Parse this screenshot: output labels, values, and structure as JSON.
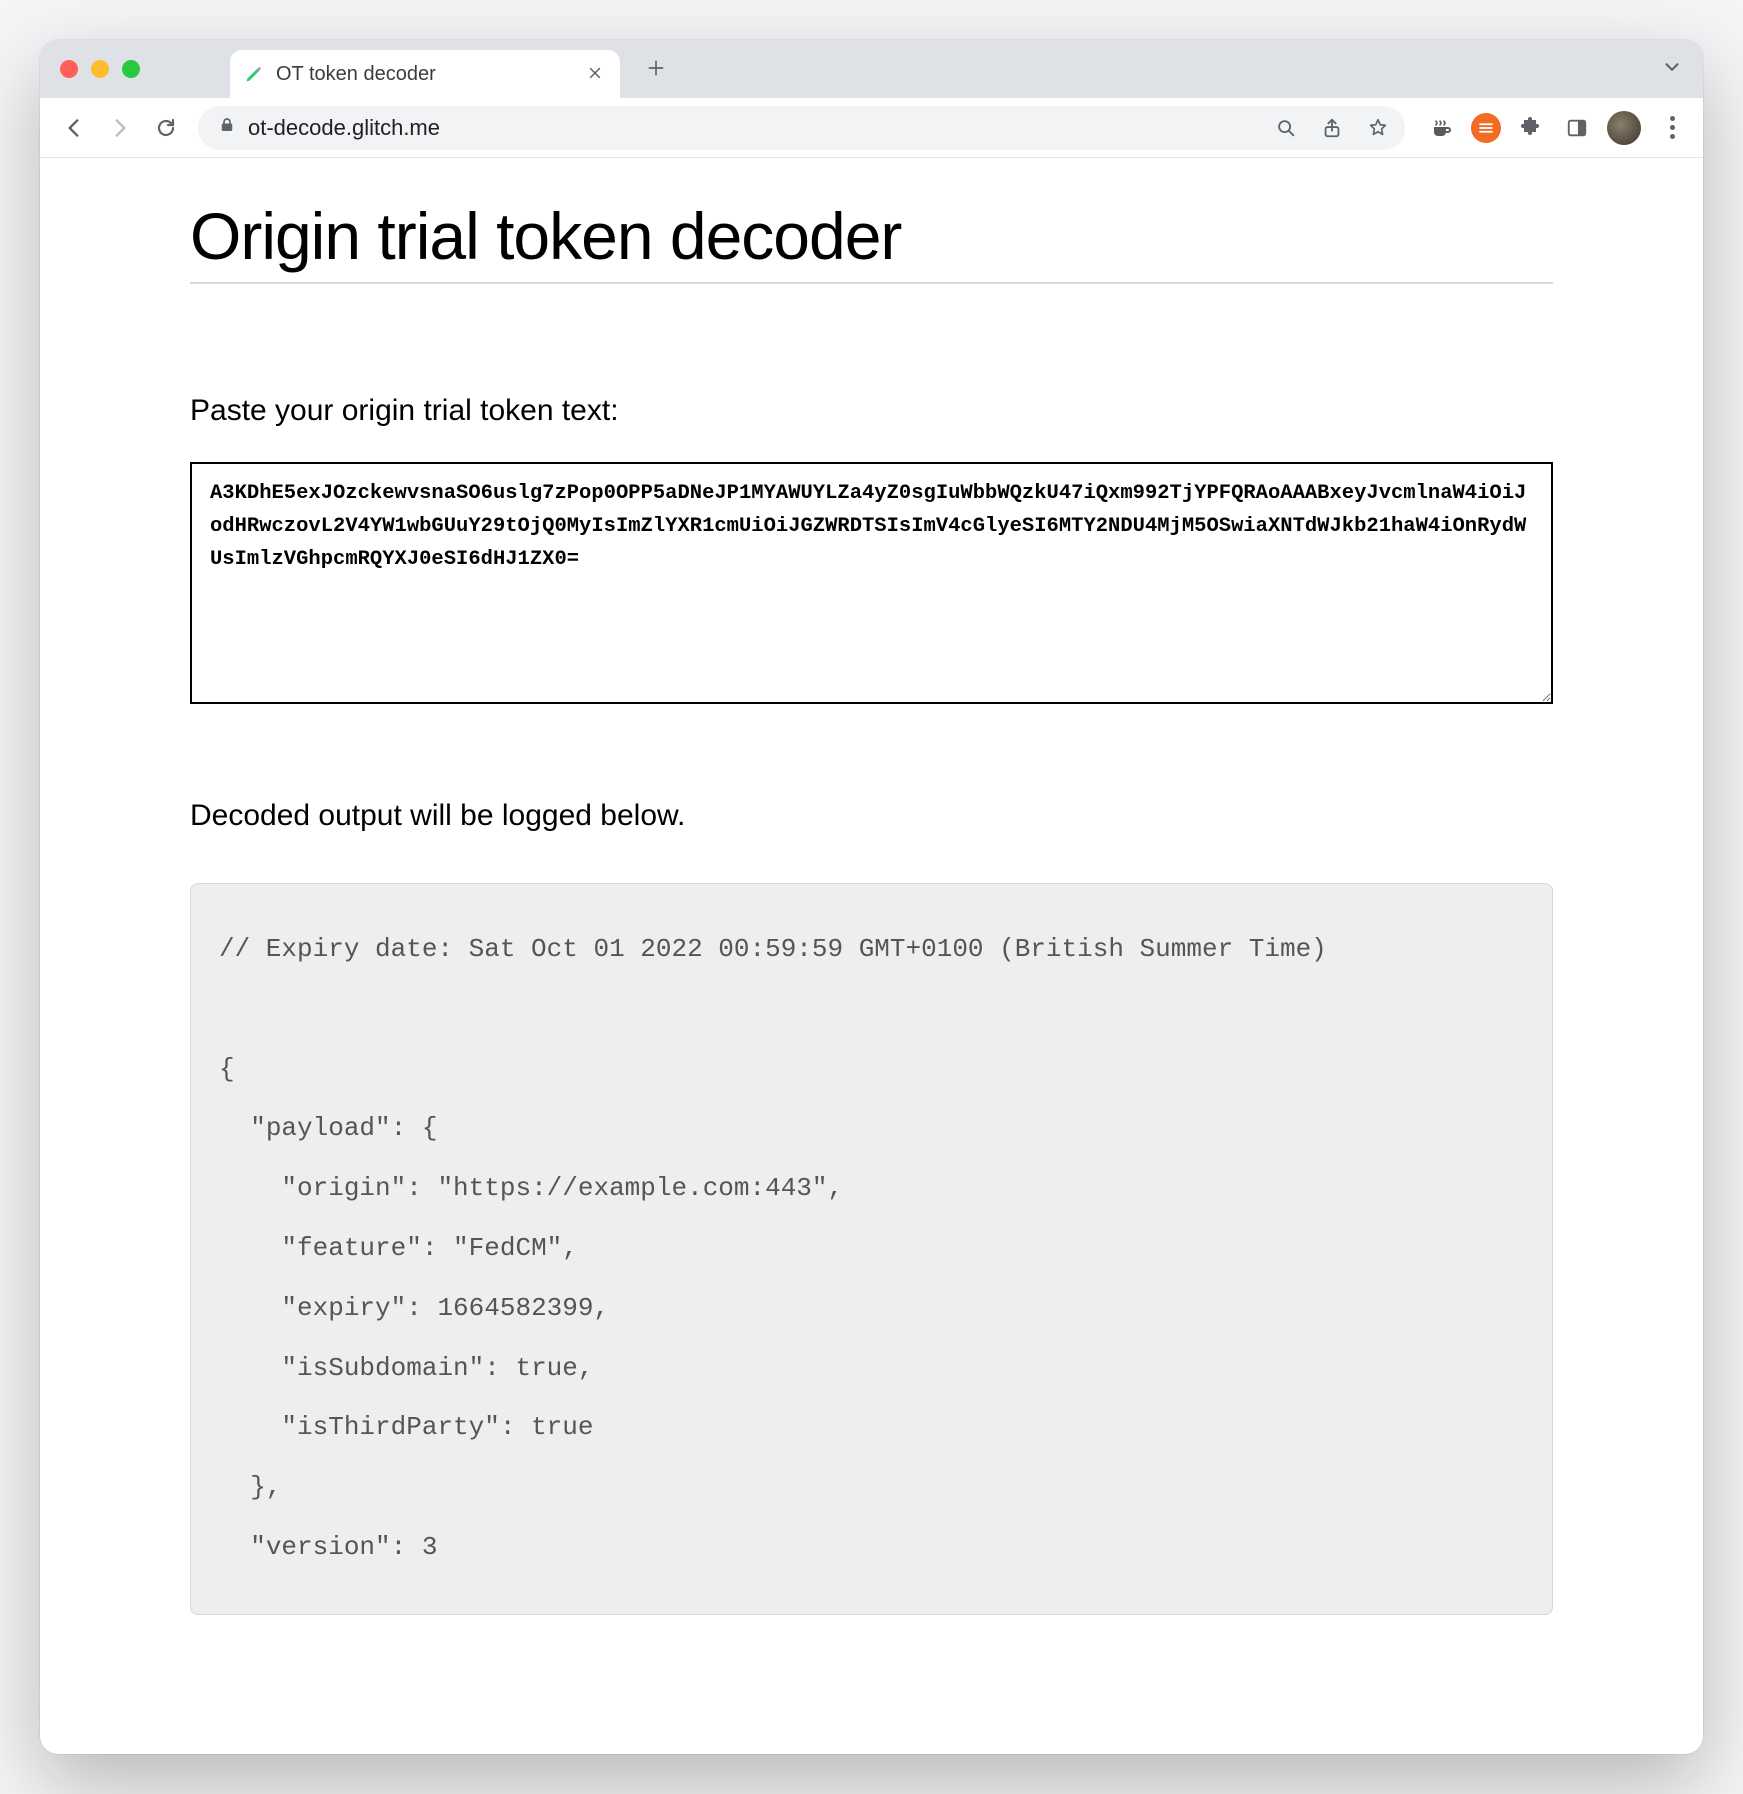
{
  "tab": {
    "title": "OT token decoder"
  },
  "omnibox": {
    "url": "ot-decode.glitch.me"
  },
  "page": {
    "title": "Origin trial token decoder",
    "paste_heading": "Paste your origin trial token text:",
    "output_heading": "Decoded output will be logged below.",
    "token_value": "A3KDhE5exJOzckewvsnaSO6uslg7zPop0OPP5aDNeJP1MYAWUYLZa4yZ0sgIuWbbWQzkU47iQxm992TjYPFQRAoAAABxeyJvcmlnaW4iOiJodHRwczovL2V4YW1wbGUuY29tOjQ0MyIsImZlYXR1cmUiOiJGZWRDTSIsImV4cGlyeSI6MTY2NDU4MjM5OSwiaXNTdWJkb21haW4iOnRydWUsImlzVGhpcmRQYXJ0eSI6dHJ1ZX0=",
    "decoded_output": "// Expiry date: Sat Oct 01 2022 00:59:59 GMT+0100 (British Summer Time)\n\n{\n  \"payload\": {\n    \"origin\": \"https://example.com:443\",\n    \"feature\": \"FedCM\",\n    \"expiry\": 1664582399,\n    \"isSubdomain\": true,\n    \"isThirdParty\": true\n  },\n  \"version\": 3"
  }
}
